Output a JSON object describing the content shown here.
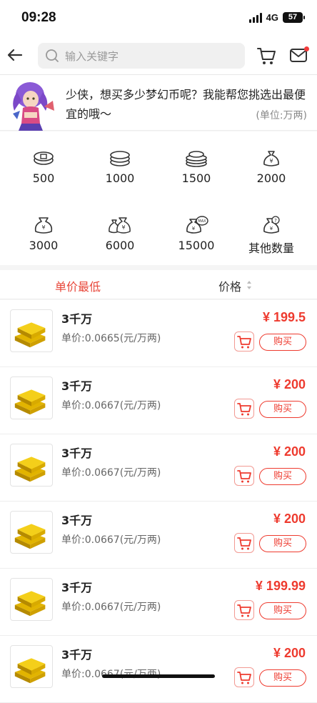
{
  "status_bar": {
    "time": "09:28",
    "network": "4G",
    "battery": "57"
  },
  "header": {
    "search_placeholder": "输入关键字"
  },
  "intro": {
    "message": "少侠，想买多少梦幻币呢？我能帮您挑选出最便宜的哦～",
    "unit_note": "(单位:万两)"
  },
  "quantities": [
    {
      "label": "500",
      "icon": "coins-small-icon"
    },
    {
      "label": "1000",
      "icon": "coins-stack-icon"
    },
    {
      "label": "1500",
      "icon": "coins-large-stack-icon"
    },
    {
      "label": "2000",
      "icon": "money-bag-icon"
    },
    {
      "label": "3000",
      "icon": "money-bag-yen-icon"
    },
    {
      "label": "6000",
      "icon": "money-bags-icon"
    },
    {
      "label": "15000",
      "icon": "money-bag-max-icon"
    },
    {
      "label": "其他数量",
      "icon": "money-bag-question-icon"
    }
  ],
  "sort": {
    "lowest_unit_price": "单价最低",
    "price": "价格"
  },
  "items": [
    {
      "title": "3千万",
      "unit_price": "单价:0.0665(元/万两)",
      "price": "¥ 199.5",
      "buy": "购买"
    },
    {
      "title": "3千万",
      "unit_price": "单价:0.0667(元/万两)",
      "price": "¥ 200",
      "buy": "购买"
    },
    {
      "title": "3千万",
      "unit_price": "单价:0.0667(元/万两)",
      "price": "¥ 200",
      "buy": "购买"
    },
    {
      "title": "3千万",
      "unit_price": "单价:0.0667(元/万两)",
      "price": "¥ 200",
      "buy": "购买"
    },
    {
      "title": "3千万",
      "unit_price": "单价:0.0667(元/万两)",
      "price": "¥ 199.99",
      "buy": "购买"
    },
    {
      "title": "3千万",
      "unit_price": "单价:0.0667(元/万两)",
      "price": "¥ 200",
      "buy": "购买"
    }
  ],
  "colors": {
    "accent": "#ee3b2f",
    "background": "#f5f5f5"
  }
}
